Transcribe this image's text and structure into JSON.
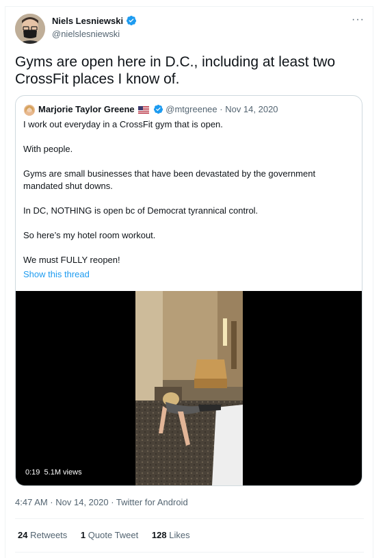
{
  "tweet": {
    "author_name": "Niels Lesniewski",
    "author_handle": "@nielslesniewski",
    "text": "Gyms are open here in D.C., including at least two CrossFit places I know of.",
    "more_icon": "···",
    "timestamp": "4:47 AM · Nov 14, 2020 · Twitter for Android"
  },
  "quoted": {
    "author_name": "Marjorie Taylor Greene",
    "handle": "@mtgreenee",
    "separator": " · ",
    "date": "Nov 14, 2020",
    "paragraphs": [
      "I work out everyday in a CrossFit gym that is open.",
      "With people.",
      "Gyms are small businesses that have been devastated by the government mandated shut downs.",
      "In DC, NOTHING is open bc of Democrat tyrannical control.",
      "So here’s my hotel room workout.",
      "We must FULLY reopen!"
    ],
    "show_thread": "Show this thread",
    "video": {
      "duration": "0:19",
      "views": "5.1M views"
    }
  },
  "stats": {
    "retweets_count": "24",
    "retweets_label": "Retweets",
    "quotes_count": "1",
    "quotes_label": "Quote Tweet",
    "likes_count": "128",
    "likes_label": "Likes"
  },
  "colors": {
    "accent": "#1d9bf0",
    "text": "#0f1419",
    "muted": "#536471",
    "border": "#cfd9de"
  }
}
